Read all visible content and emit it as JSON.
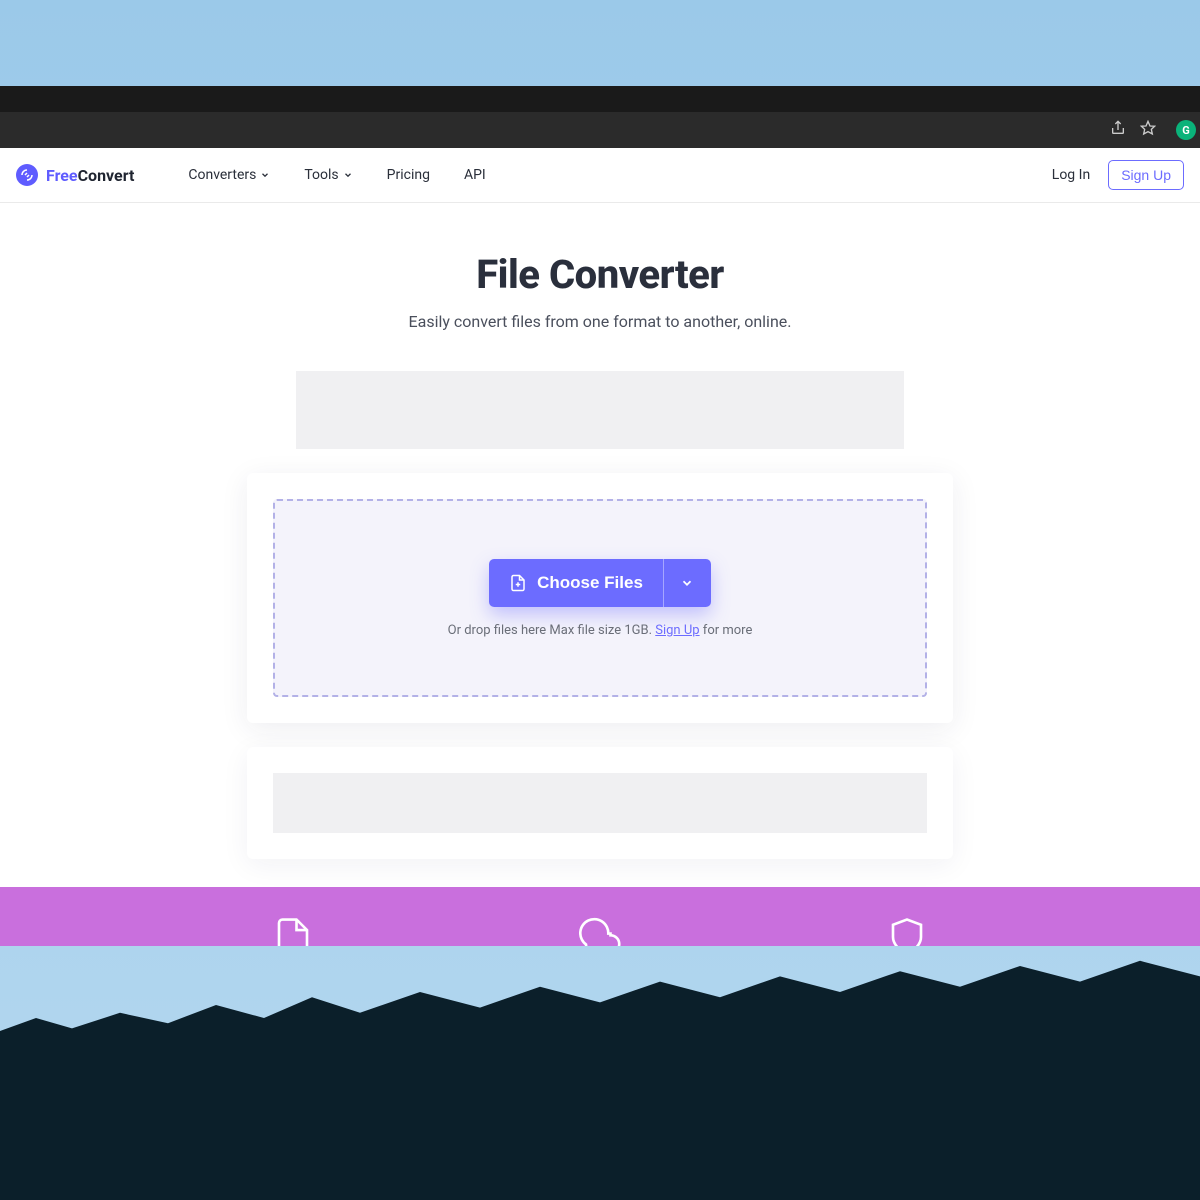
{
  "brand": {
    "prefix": "Free",
    "suffix": "Convert"
  },
  "nav": {
    "converters": "Converters",
    "tools": "Tools",
    "pricing": "Pricing",
    "api": "API",
    "login": "Log In",
    "signup": "Sign Up"
  },
  "hero": {
    "title": "File Converter",
    "subtitle": "Easily convert files from one format to another, online."
  },
  "upload": {
    "choose_label": "Choose Files",
    "drop_prefix": "Or drop files here Max file size 1GB. ",
    "signup_link": "Sign Up",
    "drop_suffix": " for more"
  },
  "colors": {
    "accent": "#6c6cff",
    "feature_bg": "#c96fdd"
  }
}
